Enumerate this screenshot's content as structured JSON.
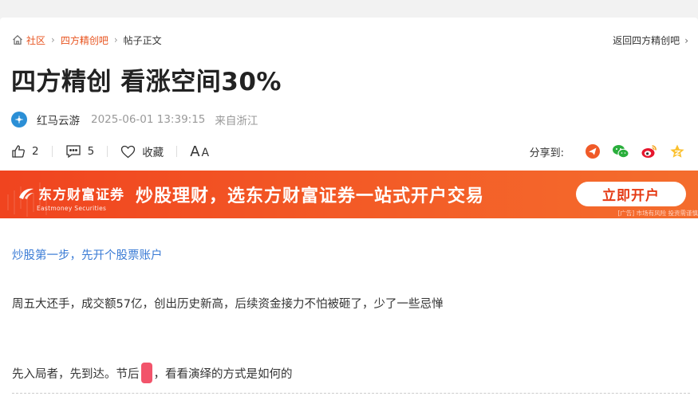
{
  "breadcrumb": {
    "home_label": "社区",
    "forum_label": "四方精创吧",
    "current_label": "帖子正文"
  },
  "back_link": "返回四方精创吧",
  "post": {
    "title": "四方精创 看涨空间30%",
    "author": "红马云游",
    "time": "2025-06-01 13:39:15",
    "location": "来自浙江"
  },
  "actions": {
    "like_count": "2",
    "comment_count": "5",
    "favorite_label": "收藏",
    "font_large": "A",
    "font_small": "A"
  },
  "share": {
    "label": "分享到:",
    "icons": [
      "send-icon",
      "wechat-icon",
      "weibo-icon",
      "qzone-star-icon"
    ]
  },
  "banner": {
    "brand_cn": "东方财富证券",
    "brand_en": "Eastmoney Securities",
    "slogan": "炒股理财，选东方财富证券一站式开户交易",
    "cta": "立即开户",
    "disclaimer": "[广告] 市场有风险 投资需谨慎"
  },
  "content": {
    "promo_link": "炒股第一步，先开个股票账户",
    "paragraph1": "周五大还手，成交额57亿，创出历史新高，后续资金接力不怕被砸了，少了一些忌惮",
    "paragraph2_before": "先入局者，先到达。节后",
    "paragraph2_after": "，看看演绎的方式是如何的"
  },
  "colors": {
    "accent": "#e8531e",
    "link": "#3a7bd5",
    "banner": "#f0441f",
    "redaction": "#f2546b"
  }
}
